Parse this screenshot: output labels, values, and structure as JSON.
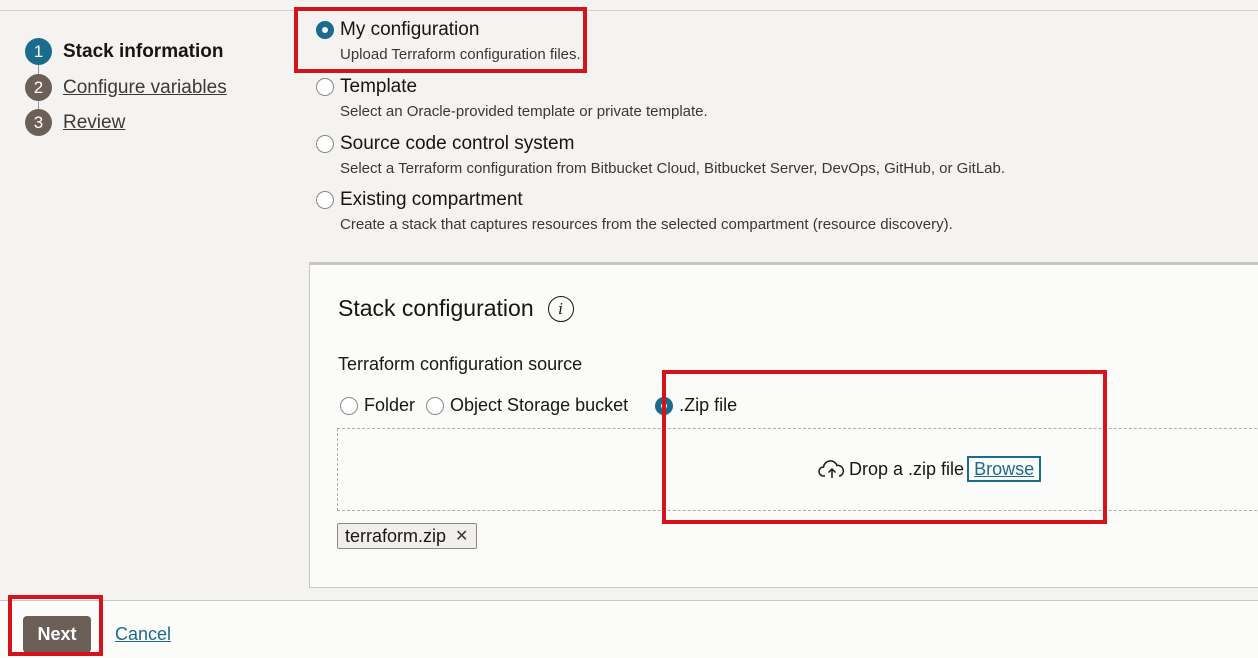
{
  "steps": [
    {
      "number": "1",
      "label": "Stack information",
      "state": "active"
    },
    {
      "number": "2",
      "label": "Configure variables",
      "state": "link"
    },
    {
      "number": "3",
      "label": "Review",
      "state": "link"
    }
  ],
  "origin_options": [
    {
      "title": "My configuration",
      "description": "Upload Terraform configuration files.",
      "selected": true
    },
    {
      "title": "Template",
      "description": "Select an Oracle-provided template or private template.",
      "selected": false
    },
    {
      "title": "Source code control system",
      "description": "Select a Terraform configuration from Bitbucket Cloud, Bitbucket Server, DevOps, GitHub, or GitLab.",
      "selected": false
    },
    {
      "title": "Existing compartment",
      "description": "Create a stack that captures resources from the selected compartment (resource discovery).",
      "selected": false
    }
  ],
  "stack_config": {
    "title": "Stack configuration",
    "info_icon": "info-icon",
    "source_label": "Terraform configuration source",
    "source_options": [
      {
        "label": "Folder",
        "selected": false
      },
      {
        "label": "Object Storage bucket",
        "selected": false
      },
      {
        "label": ".Zip file",
        "selected": true
      }
    ],
    "dropzone": {
      "icon": "cloud-upload-icon",
      "text": "Drop a .zip file",
      "browse_label": "Browse"
    },
    "uploaded_file": {
      "name": "terraform.zip",
      "remove_icon": "close-icon"
    }
  },
  "footer": {
    "next_label": "Next",
    "cancel_label": "Cancel"
  },
  "colors": {
    "accent": "#1b6b8c",
    "highlight": "#d5131b",
    "step_inactive": "#6b5f58"
  }
}
